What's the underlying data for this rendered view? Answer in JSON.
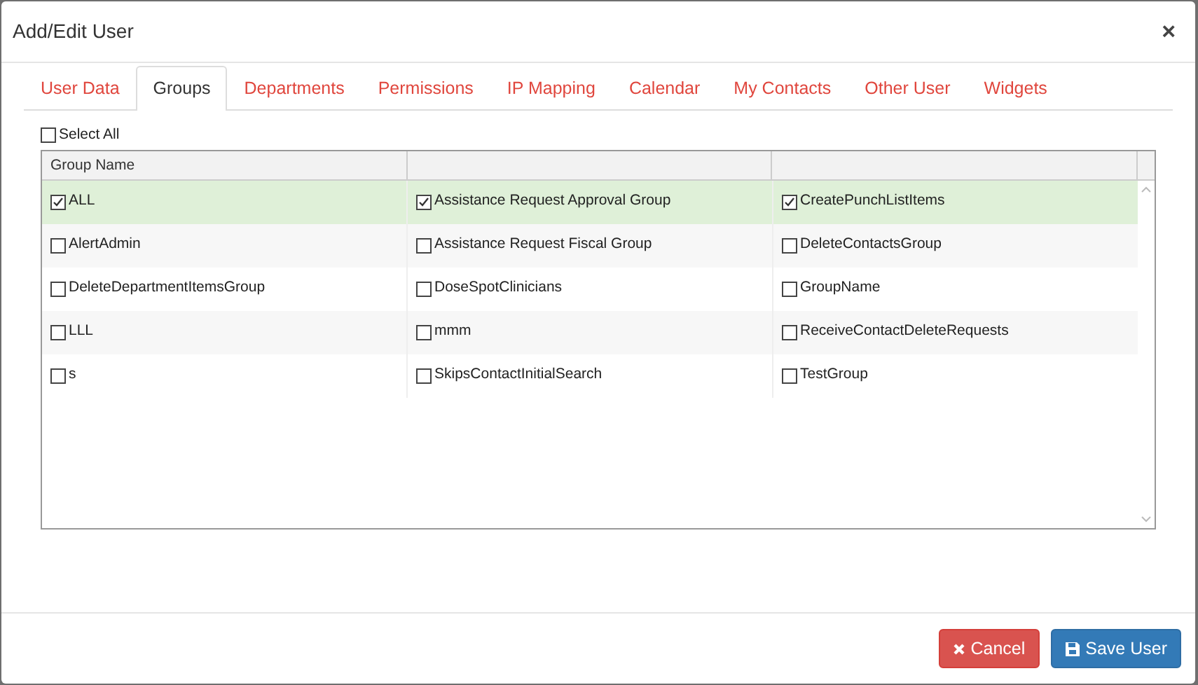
{
  "dialog": {
    "title": "Add/Edit User",
    "close": "×"
  },
  "tabs": [
    {
      "label": "User Data",
      "selected": false
    },
    {
      "label": "Groups",
      "selected": true
    },
    {
      "label": "Departments",
      "selected": false
    },
    {
      "label": "Permissions",
      "selected": false
    },
    {
      "label": "IP Mapping",
      "selected": false
    },
    {
      "label": "Calendar",
      "selected": false
    },
    {
      "label": "My Contacts",
      "selected": false
    },
    {
      "label": "Other User",
      "selected": false
    },
    {
      "label": "Widgets",
      "selected": false
    }
  ],
  "select_all": {
    "label": "Select All",
    "checked": false
  },
  "table": {
    "columns": [
      "Group Name"
    ],
    "rows": [
      {
        "selected": true,
        "cells": [
          {
            "label": "ALL",
            "checked": true
          },
          {
            "label": "Assistance Request Approval Group",
            "checked": true
          },
          {
            "label": "CreatePunchListItems",
            "checked": true
          }
        ]
      },
      {
        "selected": false,
        "cells": [
          {
            "label": "AlertAdmin",
            "checked": false
          },
          {
            "label": "Assistance Request Fiscal Group",
            "checked": false
          },
          {
            "label": "DeleteContactsGroup",
            "checked": false
          }
        ]
      },
      {
        "selected": false,
        "cells": [
          {
            "label": "DeleteDepartmentItemsGroup",
            "checked": false
          },
          {
            "label": "DoseSpotClinicians",
            "checked": false
          },
          {
            "label": "GroupName",
            "checked": false
          }
        ]
      },
      {
        "selected": false,
        "cells": [
          {
            "label": "LLL",
            "checked": false
          },
          {
            "label": "mmm",
            "checked": false
          },
          {
            "label": "ReceiveContactDeleteRequests",
            "checked": false
          }
        ]
      },
      {
        "selected": false,
        "cells": [
          {
            "label": "s",
            "checked": false
          },
          {
            "label": "SkipsContactInitialSearch",
            "checked": false
          },
          {
            "label": "TestGroup",
            "checked": false
          }
        ]
      }
    ]
  },
  "buttons": [
    {
      "kind": "cancel",
      "label": "Cancel"
    },
    {
      "kind": "save",
      "label": "Save User"
    }
  ]
}
